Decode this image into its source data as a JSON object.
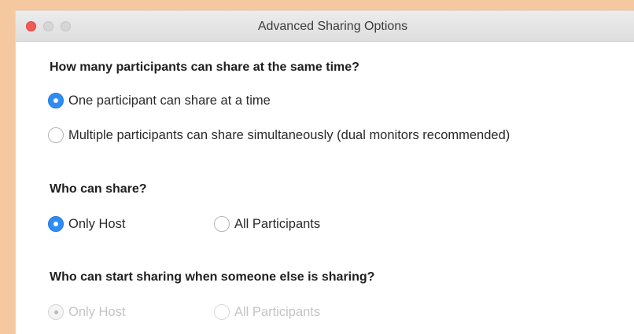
{
  "window": {
    "title": "Advanced Sharing Options"
  },
  "sections": [
    {
      "question": "How many participants can share at the same time?",
      "options": [
        {
          "label": "One participant can share at a time",
          "selected": true,
          "enabled": true
        },
        {
          "label": "Multiple participants can share simultaneously (dual monitors recommended)",
          "selected": false,
          "enabled": true
        }
      ]
    },
    {
      "question": "Who can share?",
      "options": [
        {
          "label": "Only Host",
          "selected": true,
          "enabled": true
        },
        {
          "label": "All Participants",
          "selected": false,
          "enabled": true
        }
      ]
    },
    {
      "question": "Who can start sharing when someone else is sharing?",
      "options": [
        {
          "label": "Only Host",
          "selected": true,
          "enabled": false
        },
        {
          "label": "All Participants",
          "selected": false,
          "enabled": false
        }
      ]
    }
  ],
  "colors": {
    "accent": "#2f8cf6",
    "close": "#f25b55",
    "frame": "#f5c8a0"
  }
}
